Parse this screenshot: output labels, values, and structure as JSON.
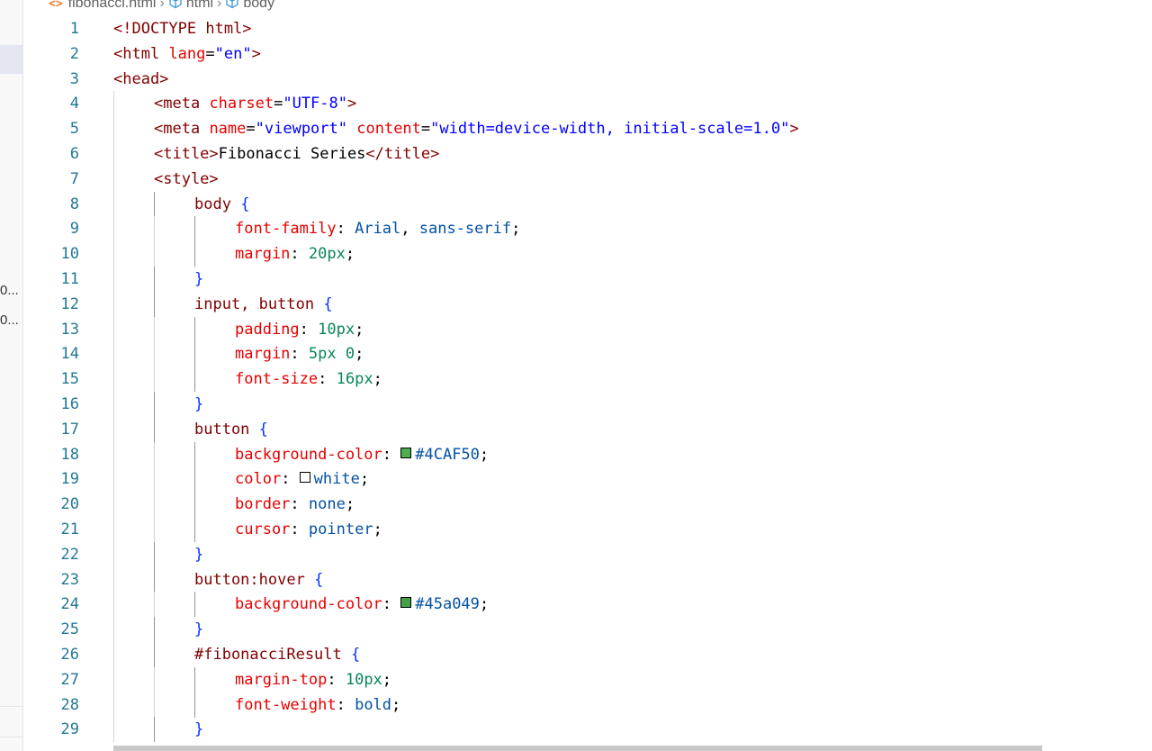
{
  "breadcrumb": {
    "file": "fibonacci.html",
    "items": [
      "html",
      "body"
    ]
  },
  "sidebar": {
    "truncated": [
      "0...",
      "0..."
    ]
  },
  "colors": {
    "line_number": "#237893",
    "tag": "#800000",
    "attribute": "#e50000",
    "string": "#0000ff",
    "css_value": "#0451a5",
    "css_number": "#098658",
    "brace": "#0431fa"
  },
  "lines": [
    {
      "n": "1",
      "indent": 0,
      "tokens": [
        [
          "tag",
          "<!DOCTYPE html>"
        ]
      ]
    },
    {
      "n": "2",
      "indent": 0,
      "tokens": [
        [
          "tag",
          "<html"
        ],
        [
          "text",
          " "
        ],
        [
          "attr",
          "lang"
        ],
        [
          "text",
          "="
        ],
        [
          "str",
          "\"en\""
        ],
        [
          "tag",
          ">"
        ]
      ]
    },
    {
      "n": "3",
      "indent": 0,
      "tokens": [
        [
          "tag",
          "<head>"
        ]
      ]
    },
    {
      "n": "4",
      "indent": 1,
      "tokens": [
        [
          "tag",
          "<meta"
        ],
        [
          "text",
          " "
        ],
        [
          "attr",
          "charset"
        ],
        [
          "text",
          "="
        ],
        [
          "str",
          "\"UTF-8\""
        ],
        [
          "tag",
          ">"
        ]
      ]
    },
    {
      "n": "5",
      "indent": 1,
      "tokens": [
        [
          "tag",
          "<meta"
        ],
        [
          "text",
          " "
        ],
        [
          "attr",
          "name"
        ],
        [
          "text",
          "="
        ],
        [
          "str",
          "\"viewport\""
        ],
        [
          "text",
          " "
        ],
        [
          "attr",
          "content"
        ],
        [
          "text",
          "="
        ],
        [
          "str",
          "\"width=device-width, initial-scale=1.0\""
        ],
        [
          "tag",
          ">"
        ]
      ]
    },
    {
      "n": "6",
      "indent": 1,
      "tokens": [
        [
          "tag",
          "<title>"
        ],
        [
          "text",
          "Fibonacci Series"
        ],
        [
          "tag",
          "</title>"
        ]
      ]
    },
    {
      "n": "7",
      "indent": 1,
      "tokens": [
        [
          "tag",
          "<style>"
        ]
      ]
    },
    {
      "n": "8",
      "indent": 2,
      "tokens": [
        [
          "sel",
          "body"
        ],
        [
          "text",
          " "
        ],
        [
          "brace",
          "{"
        ]
      ]
    },
    {
      "n": "9",
      "indent": 3,
      "tokens": [
        [
          "prop",
          "font-family"
        ],
        [
          "punc",
          ": "
        ],
        [
          "val",
          "Arial"
        ],
        [
          "punc",
          ", "
        ],
        [
          "val",
          "sans-serif"
        ],
        [
          "punc",
          ";"
        ]
      ]
    },
    {
      "n": "10",
      "indent": 3,
      "tokens": [
        [
          "prop",
          "margin"
        ],
        [
          "punc",
          ": "
        ],
        [
          "num",
          "20px"
        ],
        [
          "punc",
          ";"
        ]
      ]
    },
    {
      "n": "11",
      "indent": 2,
      "tokens": [
        [
          "brace",
          "}"
        ]
      ]
    },
    {
      "n": "12",
      "indent": 2,
      "tokens": [
        [
          "sel",
          "input, button"
        ],
        [
          "text",
          " "
        ],
        [
          "brace",
          "{"
        ]
      ]
    },
    {
      "n": "13",
      "indent": 3,
      "tokens": [
        [
          "prop",
          "padding"
        ],
        [
          "punc",
          ": "
        ],
        [
          "num",
          "10px"
        ],
        [
          "punc",
          ";"
        ]
      ]
    },
    {
      "n": "14",
      "indent": 3,
      "tokens": [
        [
          "prop",
          "margin"
        ],
        [
          "punc",
          ": "
        ],
        [
          "num",
          "5px 0"
        ],
        [
          "punc",
          ";"
        ]
      ]
    },
    {
      "n": "15",
      "indent": 3,
      "tokens": [
        [
          "prop",
          "font-size"
        ],
        [
          "punc",
          ": "
        ],
        [
          "num",
          "16px"
        ],
        [
          "punc",
          ";"
        ]
      ]
    },
    {
      "n": "16",
      "indent": 2,
      "tokens": [
        [
          "brace",
          "}"
        ]
      ]
    },
    {
      "n": "17",
      "indent": 2,
      "tokens": [
        [
          "sel",
          "button"
        ],
        [
          "text",
          " "
        ],
        [
          "brace",
          "{"
        ]
      ]
    },
    {
      "n": "18",
      "indent": 3,
      "tokens": [
        [
          "prop",
          "background-color"
        ],
        [
          "punc",
          ": "
        ],
        [
          "swatch",
          "#4CAF50"
        ],
        [
          "val",
          "#4CAF50"
        ],
        [
          "punc",
          ";"
        ]
      ]
    },
    {
      "n": "19",
      "indent": 3,
      "tokens": [
        [
          "prop",
          "color"
        ],
        [
          "punc",
          ": "
        ],
        [
          "swatch",
          "#ffffff"
        ],
        [
          "val",
          "white"
        ],
        [
          "punc",
          ";"
        ]
      ]
    },
    {
      "n": "20",
      "indent": 3,
      "tokens": [
        [
          "prop",
          "border"
        ],
        [
          "punc",
          ": "
        ],
        [
          "val",
          "none"
        ],
        [
          "punc",
          ";"
        ]
      ]
    },
    {
      "n": "21",
      "indent": 3,
      "tokens": [
        [
          "prop",
          "cursor"
        ],
        [
          "punc",
          ": "
        ],
        [
          "val",
          "pointer"
        ],
        [
          "punc",
          ";"
        ]
      ]
    },
    {
      "n": "22",
      "indent": 2,
      "tokens": [
        [
          "brace",
          "}"
        ]
      ]
    },
    {
      "n": "23",
      "indent": 2,
      "tokens": [
        [
          "sel",
          "button:hover"
        ],
        [
          "text",
          " "
        ],
        [
          "brace",
          "{"
        ]
      ]
    },
    {
      "n": "24",
      "indent": 3,
      "tokens": [
        [
          "prop",
          "background-color"
        ],
        [
          "punc",
          ": "
        ],
        [
          "swatch",
          "#45a049"
        ],
        [
          "val",
          "#45a049"
        ],
        [
          "punc",
          ";"
        ]
      ]
    },
    {
      "n": "25",
      "indent": 2,
      "tokens": [
        [
          "brace",
          "}"
        ]
      ]
    },
    {
      "n": "26",
      "indent": 2,
      "tokens": [
        [
          "sel",
          "#fibonacciResult"
        ],
        [
          "text",
          " "
        ],
        [
          "brace",
          "{"
        ]
      ]
    },
    {
      "n": "27",
      "indent": 3,
      "tokens": [
        [
          "prop",
          "margin-top"
        ],
        [
          "punc",
          ": "
        ],
        [
          "num",
          "10px"
        ],
        [
          "punc",
          ";"
        ]
      ]
    },
    {
      "n": "28",
      "indent": 3,
      "tokens": [
        [
          "prop",
          "font-weight"
        ],
        [
          "punc",
          ": "
        ],
        [
          "val",
          "bold"
        ],
        [
          "punc",
          ";"
        ]
      ]
    },
    {
      "n": "29",
      "indent": 2,
      "tokens": [
        [
          "brace",
          "}"
        ]
      ]
    }
  ]
}
